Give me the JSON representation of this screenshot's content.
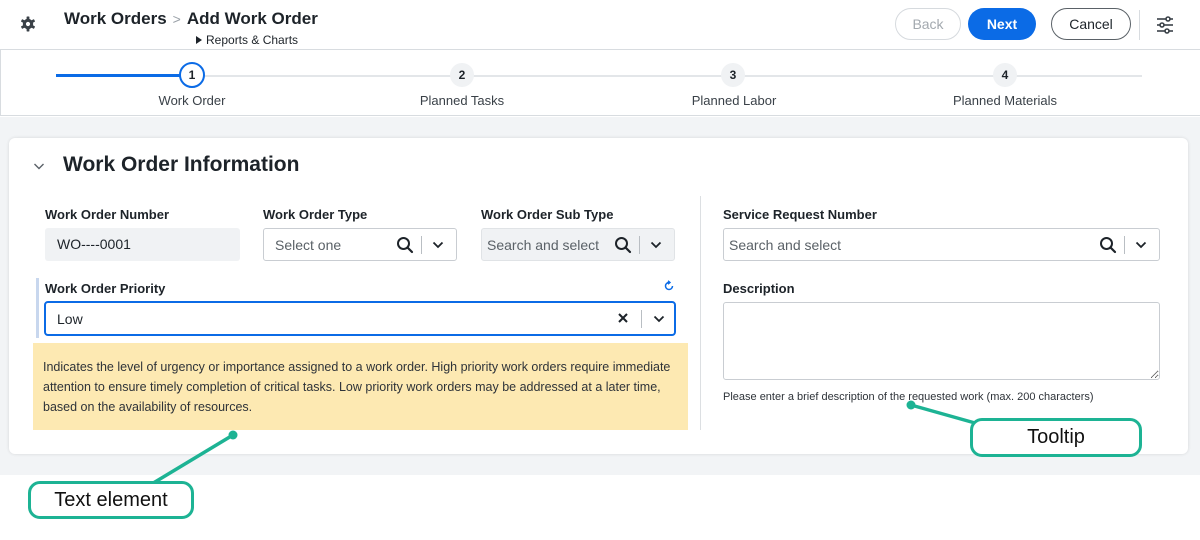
{
  "header": {
    "module": "Work Orders",
    "separator": ">",
    "page": "Add Work Order",
    "subcrumb": "Reports & Charts",
    "back_label": "Back",
    "next_label": "Next",
    "cancel_label": "Cancel"
  },
  "stepper": {
    "active_step": 1,
    "steps": [
      {
        "number": "1",
        "label": "Work Order"
      },
      {
        "number": "2",
        "label": "Planned Tasks"
      },
      {
        "number": "3",
        "label": "Planned Labor"
      },
      {
        "number": "4",
        "label": "Planned Materials"
      }
    ]
  },
  "section": {
    "title": "Work Order Information"
  },
  "fields": {
    "wo_number_label": "Work Order Number",
    "wo_number_value": "WO----0001",
    "wo_type_label": "Work Order Type",
    "wo_type_placeholder": "Select one",
    "wo_subtype_label": "Work Order Sub Type",
    "wo_subtype_placeholder": "Search and select",
    "sr_number_label": "Service Request Number",
    "sr_number_placeholder": "Search and select",
    "priority_label": "Work Order Priority",
    "priority_value": "Low",
    "priority_help": "Indicates the level of urgency or importance assigned to a work order. High priority work orders require immediate attention to ensure timely completion of critical tasks. Low priority work orders may be addressed at a later time, based on the availability of resources.",
    "description_label": "Description",
    "description_hint": "Please enter a brief description of the requested work (max. 200 characters)"
  },
  "annotations": {
    "text_element": "Text element",
    "tooltip": "Tooltip"
  },
  "colors": {
    "primary": "#0b6be6",
    "help_background": "#fde9b2",
    "callout": "#1db394"
  }
}
